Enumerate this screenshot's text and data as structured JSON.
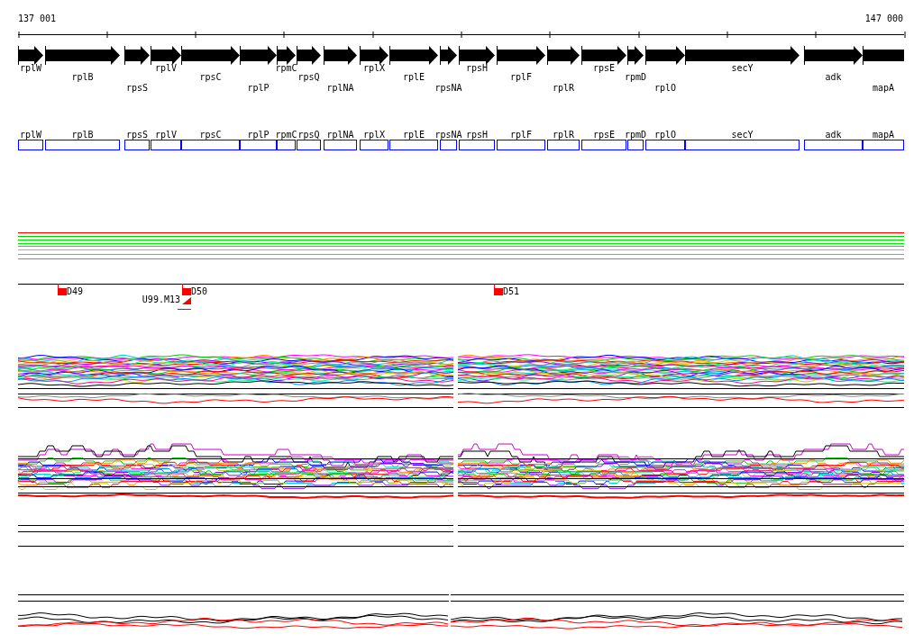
{
  "ruler": {
    "start": "137 001",
    "end": "147 000"
  },
  "genes": [
    "rplW",
    "rplB",
    "rpsS",
    "rplV",
    "rpsC",
    "rplP",
    "rpmC",
    "rpsQ",
    "rplNA",
    "rplX",
    "rplE",
    "rpsNA",
    "rpsH",
    "rplF",
    "rplR",
    "rpsE",
    "rpmD",
    "rplO",
    "secY",
    "adk",
    "mapA"
  ],
  "gene_boxes": [
    "rplW",
    "rplB",
    "rpsS",
    "rplV",
    "rpsC",
    "rplP",
    "rpmC",
    "rpsQ",
    "rplNA",
    "rplX",
    "rplE",
    "rpsNA",
    "rpsH",
    "rplF",
    "rplR",
    "rpsE",
    "rpmD",
    "rplO",
    "secY",
    "adk",
    "mapA"
  ],
  "markers": [
    "D49",
    "D50",
    "D51"
  ],
  "probe": "U99.M13"
}
